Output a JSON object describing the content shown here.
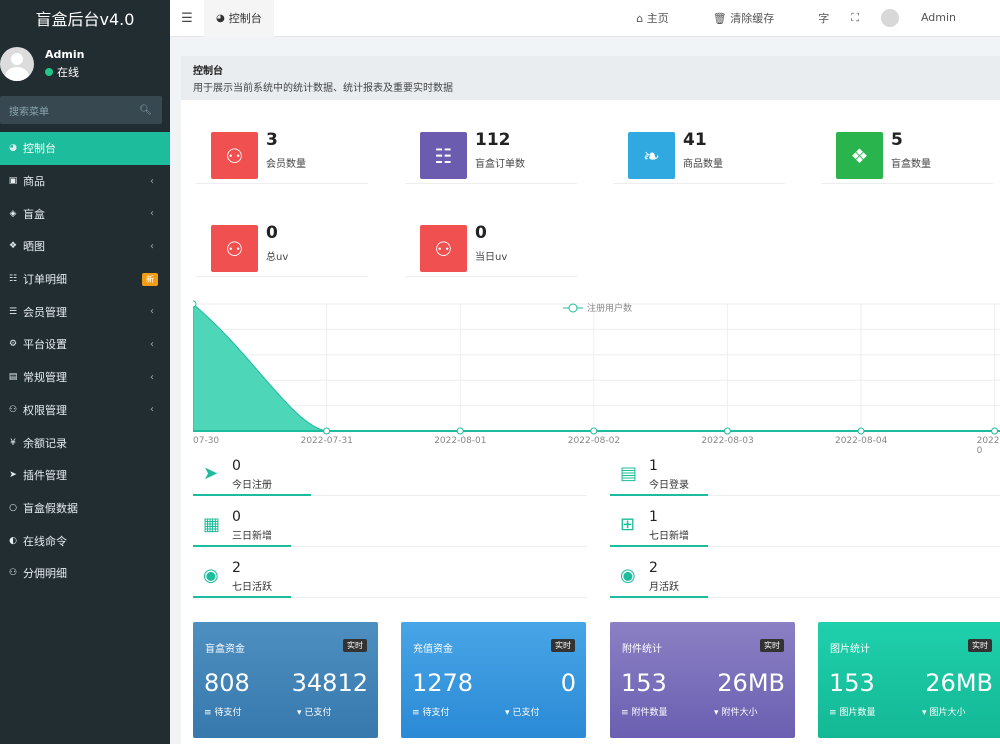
{
  "app": {
    "title": "盲盒后台v4.0"
  },
  "user": {
    "name": "Admin",
    "status": "在线"
  },
  "search": {
    "placeholder": "搜索菜单"
  },
  "sidebar": {
    "items": [
      {
        "label": "控制台",
        "icon": "dashboard-icon",
        "active": true
      },
      {
        "label": "商品",
        "icon": "shopping-bag-icon"
      },
      {
        "label": "盲盒",
        "icon": "cube-icon"
      },
      {
        "label": "晒图",
        "icon": "gift-icon"
      },
      {
        "label": "订单明细",
        "icon": "cart-icon",
        "badge": "新"
      },
      {
        "label": "会员管理",
        "icon": "list-icon"
      },
      {
        "label": "平台设置",
        "icon": "gear-icon"
      },
      {
        "label": "常规管理",
        "icon": "briefcase-icon"
      },
      {
        "label": "权限管理",
        "icon": "group-icon"
      },
      {
        "label": "余额记录",
        "icon": "yen-icon"
      },
      {
        "label": "插件管理",
        "icon": "rocket-icon"
      },
      {
        "label": "盲盒假数据",
        "icon": "circle-icon"
      },
      {
        "label": "在线命令",
        "icon": "half-circle-icon"
      },
      {
        "label": "分佣明细",
        "icon": "users-icon"
      }
    ]
  },
  "header": {
    "tab": "控制台",
    "home": "主页",
    "clear_cache": "清除缓存",
    "user": "Admin"
  },
  "content": {
    "title": "控制台",
    "desc": "用于展示当前系统中的统计数据、统计报表及重要实时数据"
  },
  "stats": [
    {
      "value": "3",
      "label": "会员数量",
      "color": "#f0504f",
      "icon": "users-icon"
    },
    {
      "value": "112",
      "label": "盲盒订单数",
      "color": "#6c5cb0",
      "icon": "cart-icon"
    },
    {
      "value": "41",
      "label": "商品数量",
      "color": "#2fa9e0",
      "icon": "leaf-icon"
    },
    {
      "value": "5",
      "label": "盲盒数量",
      "color": "#2ab44e",
      "icon": "dropbox-icon"
    },
    {
      "value": "0",
      "label": "总uv",
      "color": "#f0504f",
      "icon": "users-icon"
    },
    {
      "value": "0",
      "label": "当日uv",
      "color": "#f0504f",
      "icon": "users-icon"
    }
  ],
  "chart_data": {
    "type": "area",
    "x": [
      "07-30",
      "2022-07-31",
      "2022-08-01",
      "2022-08-02",
      "2022-08-03",
      "2022-08-04",
      "2022-0"
    ],
    "series": [
      {
        "name": "注册用户数",
        "values": [
          1,
          0,
          0,
          0,
          0,
          0,
          0
        ]
      }
    ],
    "legend": "top-center",
    "color": "#1cbc9c"
  },
  "quick": [
    {
      "value": "0",
      "label": "今日注册",
      "icon": "rocket-icon"
    },
    {
      "value": "1",
      "label": "今日登录",
      "icon": "id-card-icon"
    },
    {
      "value": "0",
      "label": "三日新增",
      "icon": "calendar-icon"
    },
    {
      "value": "1",
      "label": "七日新增",
      "icon": "calendar-plus-icon"
    },
    {
      "value": "2",
      "label": "七日活跃",
      "icon": "user-circle-icon"
    },
    {
      "value": "2",
      "label": "月活跃",
      "icon": "user-circle-icon"
    }
  ],
  "cards": [
    {
      "title": "盲盒资金",
      "badge": "实时",
      "v1": "808",
      "v2": "34812",
      "l1": "待支付",
      "l2": "已支付",
      "c1": "#4e8fc1",
      "c2": "#3779ad"
    },
    {
      "title": "充值资金",
      "badge": "实时",
      "v1": "1278",
      "v2": "0",
      "l1": "待支付",
      "l2": "已支付",
      "c1": "#48a5e6",
      "c2": "#2b8ad6"
    },
    {
      "title": "附件统计",
      "badge": "实时",
      "v1": "153",
      "v2": "26MB",
      "l1": "附件数量",
      "l2": "附件大小",
      "c1": "#8b80c4",
      "c2": "#6a5fb1"
    },
    {
      "title": "图片统计",
      "badge": "实时",
      "v1": "153",
      "v2": "26MB",
      "l1": "图片数量",
      "l2": "图片大小",
      "c1": "#1fd0ac",
      "c2": "#14b895"
    }
  ]
}
